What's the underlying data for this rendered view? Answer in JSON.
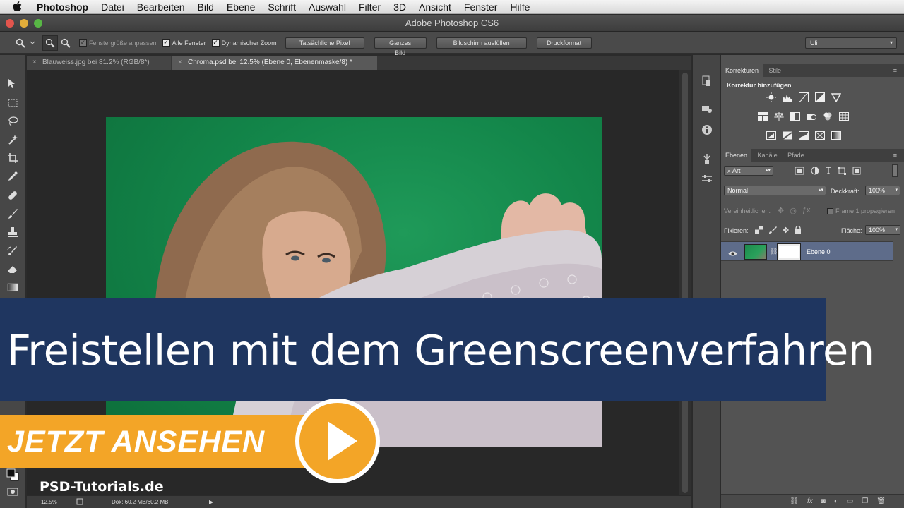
{
  "menubar": {
    "app_name": "Photoshop",
    "items": [
      "Datei",
      "Bearbeiten",
      "Bild",
      "Ebene",
      "Schrift",
      "Auswahl",
      "Filter",
      "3D",
      "Ansicht",
      "Fenster",
      "Hilfe"
    ]
  },
  "window": {
    "title": "Adobe Photoshop CS6"
  },
  "options_bar": {
    "fit_window_label": "Fenstergröße anpassen",
    "all_windows_label": "Alle Fenster",
    "scrubby_zoom_label": "Dynamischer Zoom",
    "actual_pixels_label": "Tatsächliche Pixel",
    "fit_screen_label": "Ganzes Bild",
    "fill_screen_label": "Bildschirm ausfüllen",
    "print_size_label": "Druckformat",
    "workspace_value": "Uli"
  },
  "doc_tabs": [
    {
      "label": "Blauweiss.jpg bei 81.2% (RGB/8*)"
    },
    {
      "label": "Chroma.psd bei 12.5% (Ebene 0, Ebenenmaske/8) *"
    }
  ],
  "status": {
    "zoom": "12.5%",
    "doc_size": "Dok: 60.2 MB/60.2 MB"
  },
  "adjustments": {
    "tabs": [
      "Korrekturen",
      "Stile"
    ],
    "heading": "Korrektur hinzufügen"
  },
  "layers": {
    "tabs": [
      "Ebenen",
      "Kanäle",
      "Pfade"
    ],
    "filter_kind": "Art",
    "blend_mode": "Normal",
    "opacity_label": "Deckkraft:",
    "opacity_value": "100%",
    "unify_label": "Vereinheitlichen:",
    "propagate_label": "Frame 1 propagieren",
    "lock_label": "Fixieren:",
    "fill_label": "Fläche:",
    "fill_value": "100%",
    "layer_name": "Ebene 0"
  },
  "overlay": {
    "headline": "Freistellen mit dem Greenscreenverfahren",
    "cta": "JETZT ANSEHEN",
    "brand": "PSD-Tutorials.de"
  },
  "colors": {
    "banner_bg": "#1f3660",
    "cta_orange": "#f3a527",
    "green_screen": "#13864a",
    "selected_layer": "#5e6c8a"
  }
}
